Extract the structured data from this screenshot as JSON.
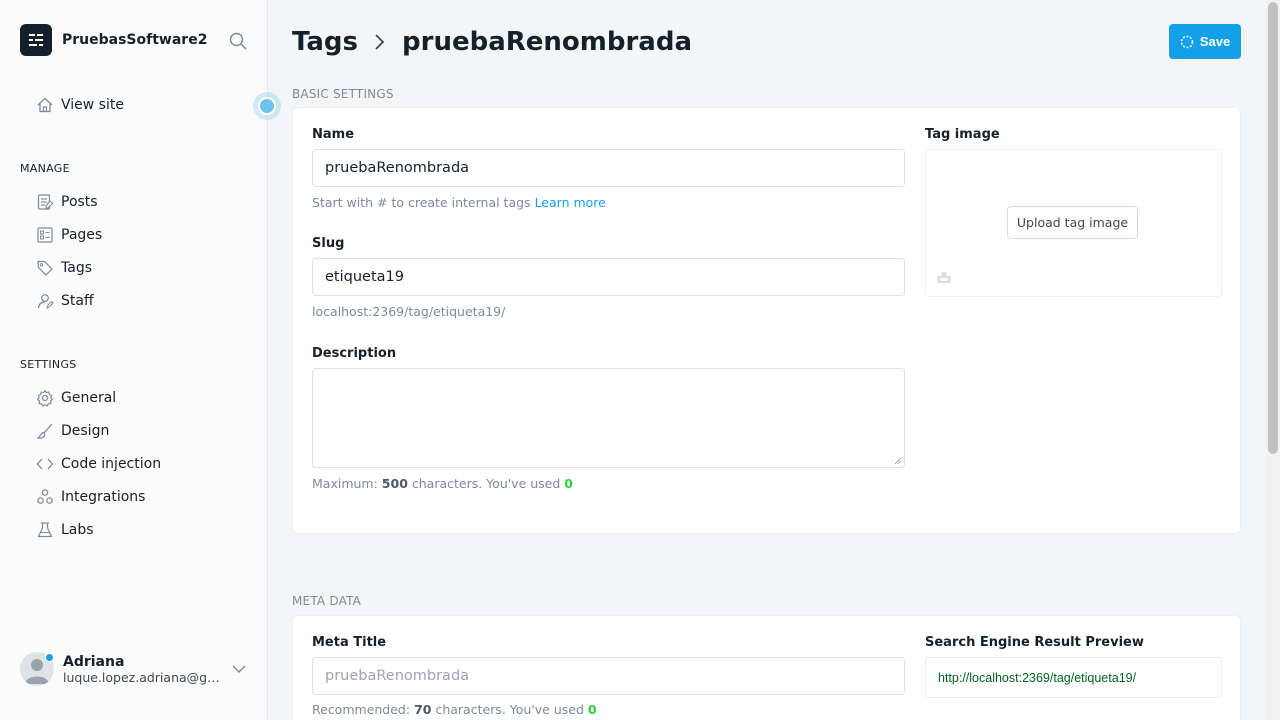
{
  "app": {
    "site_name": "PruebasSoftware2"
  },
  "sidebar": {
    "view_site": "View site",
    "manage_label": "MANAGE",
    "manage_items": [
      {
        "label": "Posts",
        "icon": "posts-icon"
      },
      {
        "label": "Pages",
        "icon": "pages-icon"
      },
      {
        "label": "Tags",
        "icon": "tag-icon"
      },
      {
        "label": "Staff",
        "icon": "staff-icon"
      }
    ],
    "settings_label": "SETTINGS",
    "settings_items": [
      {
        "label": "General",
        "icon": "gear-icon"
      },
      {
        "label": "Design",
        "icon": "brush-icon"
      },
      {
        "label": "Code injection",
        "icon": "code-icon"
      },
      {
        "label": "Integrations",
        "icon": "integrations-icon"
      },
      {
        "label": "Labs",
        "icon": "flask-icon"
      }
    ],
    "user": {
      "name": "Adriana",
      "email": "luque.lopez.adriana@gm..."
    }
  },
  "header": {
    "crumb_parent": "Tags",
    "crumb_current": "pruebaRenombrada",
    "save_label": "Save"
  },
  "basic": {
    "title": "BASIC SETTINGS",
    "name_label": "Name",
    "name_value": "pruebaRenombrada",
    "name_hint": "Start with # to create internal tags",
    "learn_more": "Learn more",
    "slug_label": "Slug",
    "slug_value": "etiqueta19",
    "slug_url": "localhost:2369/tag/etiqueta19/",
    "description_label": "Description",
    "description_value": "",
    "desc_hint_prefix": "Maximum:",
    "desc_max": "500",
    "desc_hint_middle": "characters. You've used",
    "desc_used": "0",
    "tag_image_label": "Tag image",
    "upload_label": "Upload tag image"
  },
  "meta": {
    "title": "META DATA",
    "meta_title_label": "Meta Title",
    "meta_title_placeholder": "pruebaRenombrada",
    "meta_hint_prefix": "Recommended:",
    "meta_max": "70",
    "meta_hint_middle": "characters. You've used",
    "meta_used": "0",
    "serp_label": "Search Engine Result Preview",
    "serp_url": "http://localhost:2369/tag/etiqueta19/"
  },
  "colors": {
    "accent": "#14a0e6",
    "count_green": "#30cf43",
    "serp_green": "#006621"
  }
}
